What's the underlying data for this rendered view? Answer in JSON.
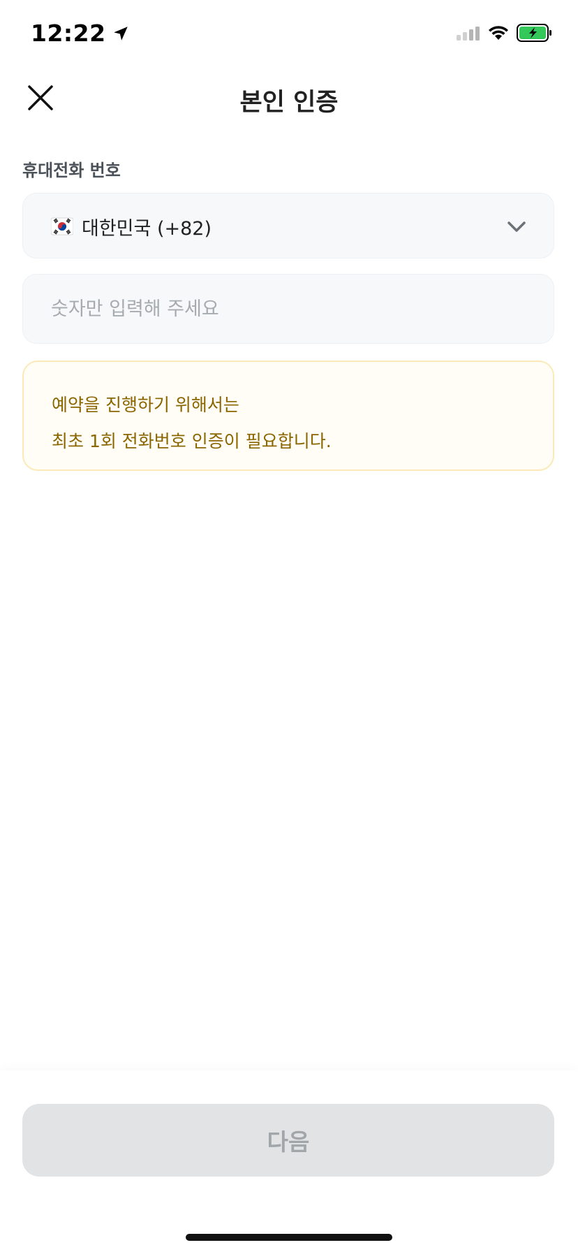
{
  "status_bar": {
    "time": "12:22",
    "icons": [
      "location-arrow-icon",
      "cellular-signal-icon",
      "wifi-icon",
      "battery-charging-icon"
    ]
  },
  "header": {
    "title": "본인 인증",
    "close_icon": "close-icon"
  },
  "form": {
    "phone_label": "휴대전화 번호",
    "country": {
      "flag_icon": "korea-flag-icon",
      "value": "대한민국 (+82)",
      "chevron_icon": "chevron-down-icon"
    },
    "phone_input": {
      "value": "",
      "placeholder": "숫자만 입력해 주세요"
    }
  },
  "notice": {
    "line1": "예약을 진행하기 위해서는",
    "line2": "최초 1회 전화번호 인증이 필요합니다.",
    "text_color": "#8b6500",
    "background": "#fffdf5"
  },
  "footer": {
    "next_label": "다음",
    "next_state": "disabled"
  }
}
